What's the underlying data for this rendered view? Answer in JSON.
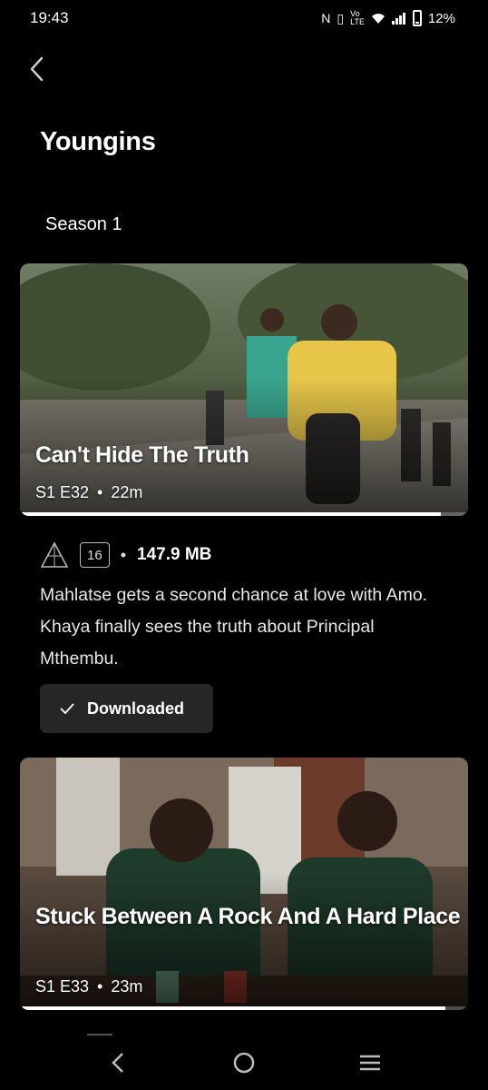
{
  "status_bar": {
    "time": "19:43",
    "battery": "12%",
    "icons": [
      "nfc-icon",
      "vibrate-icon",
      "volte-icon",
      "wifi-icon",
      "signal-icon",
      "battery-icon"
    ]
  },
  "header": {
    "title": "Youngins",
    "back_icon": "chevron-left-icon"
  },
  "season": {
    "label": "Season 1"
  },
  "episodes": [
    {
      "title": "Can't Hide The Truth",
      "code": "S1 E32",
      "separator": "•",
      "duration": "22m",
      "watched_fraction": 0.94
    },
    {
      "title": "Stuck Between A Rock And A Hard Place",
      "code": "S1 E33",
      "separator": "•",
      "duration": "23m",
      "watched_fraction": 0.95
    }
  ],
  "details": {
    "rating_logo": "fpb-logo",
    "age_rating": "16",
    "separator": "•",
    "file_size": "147.9 MB",
    "description": "Mahlatse gets a second chance at love with Amo. Khaya finally sees the truth about Principal Mthembu.",
    "download_label": "Downloaded",
    "download_icon": "checkmark-icon"
  },
  "nav_bar": {
    "icons": [
      "back-icon",
      "home-icon",
      "recents-icon"
    ]
  },
  "colors": {
    "background": "#000000",
    "button_bg": "#262626",
    "text": "#ffffff"
  }
}
